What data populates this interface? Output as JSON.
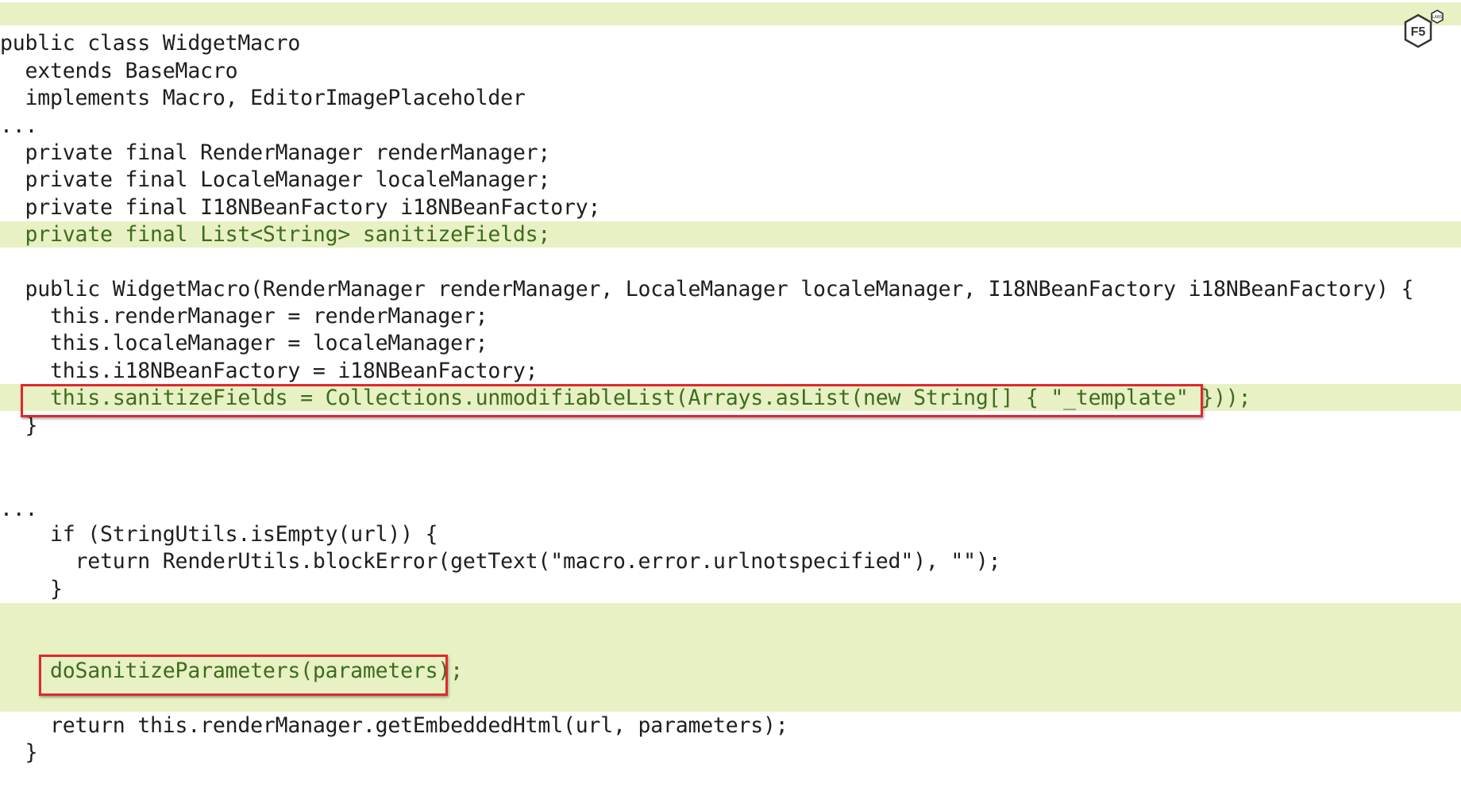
{
  "logo": {
    "main_text": "F5",
    "badge_text": "LABS"
  },
  "code": {
    "lines": [
      {
        "text": "public class WidgetMacro",
        "added": false
      },
      {
        "text": "  extends BaseMacro",
        "added": false
      },
      {
        "text": "  implements Macro, EditorImagePlaceholder",
        "added": false
      },
      {
        "text": "...",
        "added": false
      },
      {
        "text": "  private final RenderManager renderManager;",
        "added": false
      },
      {
        "text": "  private final LocaleManager localeManager;",
        "added": false
      },
      {
        "text": "  private final I18NBeanFactory i18NBeanFactory;",
        "added": false
      },
      {
        "text": "  private final List<String> sanitizeFields;",
        "added": true
      },
      {
        "text": "  public WidgetMacro(RenderManager renderManager, LocaleManager localeManager, I18NBeanFactory i18NBeanFactory) {",
        "added": false
      },
      {
        "text": "    this.renderManager = renderManager;",
        "added": false
      },
      {
        "text": "    this.localeManager = localeManager;",
        "added": false
      },
      {
        "text": "    this.i18NBeanFactory = i18NBeanFactory;",
        "added": false
      },
      {
        "text": "    this.sanitizeFields = Collections.unmodifiableList(Arrays.asList(new String[] { \"_template\" }));",
        "added": true
      },
      {
        "text": "  }",
        "added": false
      },
      {
        "text": "...",
        "added": false
      },
      {
        "text": "    if (StringUtils.isEmpty(url)) {",
        "added": false
      },
      {
        "text": "      return RenderUtils.blockError(getText(\"macro.error.urlnotspecified\"), \"\");",
        "added": false
      },
      {
        "text": "    }",
        "added": false
      },
      {
        "text": "    doSanitizeParameters(parameters);",
        "added": true
      },
      {
        "text": "    return this.renderManager.getEmbeddedHtml(url, parameters);",
        "added": false
      },
      {
        "text": "  }",
        "added": false
      }
    ]
  },
  "colors": {
    "highlight": "#e7f1c4",
    "added_text": "#3f6b1e",
    "callout_box": "#e0282e"
  }
}
